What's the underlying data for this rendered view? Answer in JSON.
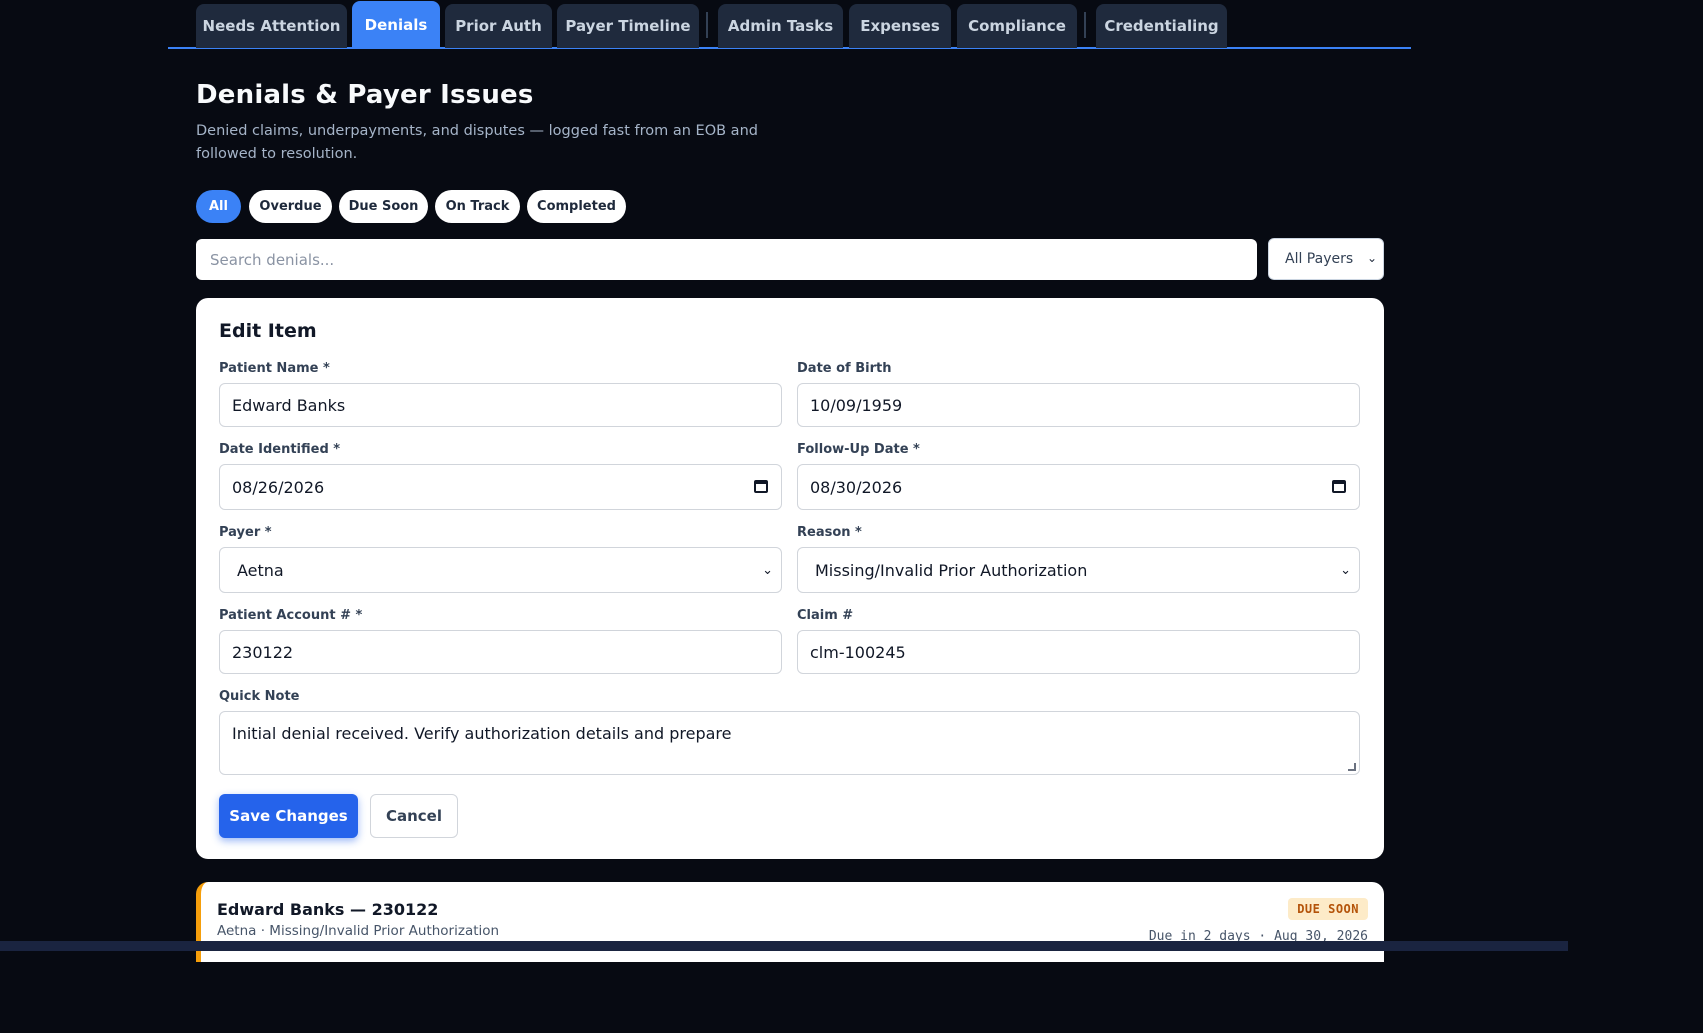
{
  "tabs": [
    {
      "label": "Needs Attention"
    },
    {
      "label": "Denials"
    },
    {
      "label": "Prior Auth"
    },
    {
      "label": "Payer Timeline"
    },
    {
      "label": "Admin Tasks"
    },
    {
      "label": "Expenses"
    },
    {
      "label": "Compliance"
    },
    {
      "label": "Credentialing"
    }
  ],
  "active_tab": "Denials",
  "header": {
    "title": "Denials & Payer Issues",
    "subtitle": "Denied claims, underpayments, and disputes — logged fast from an EOB and followed to resolution."
  },
  "filters": [
    {
      "label": "All"
    },
    {
      "label": "Overdue"
    },
    {
      "label": "Due Soon"
    },
    {
      "label": "On Track"
    },
    {
      "label": "Completed"
    }
  ],
  "active_filter": "All",
  "search": {
    "placeholder": "Search denials..."
  },
  "payer_filter": {
    "value": "All Payers"
  },
  "edit_form": {
    "title": "Edit Item",
    "patient_name": {
      "label": "Patient Name *",
      "value": "Edward Banks"
    },
    "dob": {
      "label": "Date of Birth",
      "value": "10/09/1959"
    },
    "date_identified": {
      "label": "Date Identified *",
      "value": "08/26/2026"
    },
    "follow_up": {
      "label": "Follow-Up Date *",
      "value": "08/30/2026"
    },
    "payer": {
      "label": "Payer *",
      "value": "Aetna"
    },
    "reason": {
      "label": "Reason *",
      "value": "Missing/Invalid Prior Authorization"
    },
    "account": {
      "label": "Patient Account # *",
      "value": "230122"
    },
    "claim": {
      "label": "Claim #",
      "value": "clm-100245"
    },
    "note": {
      "label": "Quick Note",
      "value": "Initial denial received. Verify authorization details and prepare"
    },
    "save_label": "Save Changes",
    "cancel_label": "Cancel"
  },
  "items": [
    {
      "title": "Edward Banks — 230122",
      "subtitle": "Aetna · Missing/Invalid Prior Authorization",
      "badge": "DUE SOON",
      "due": "Due in 2 days · Aug 30, 2026"
    }
  ],
  "colors": {
    "accent": "#3b82f6",
    "background": "#070a12",
    "due_soon": "#f59e0b"
  }
}
